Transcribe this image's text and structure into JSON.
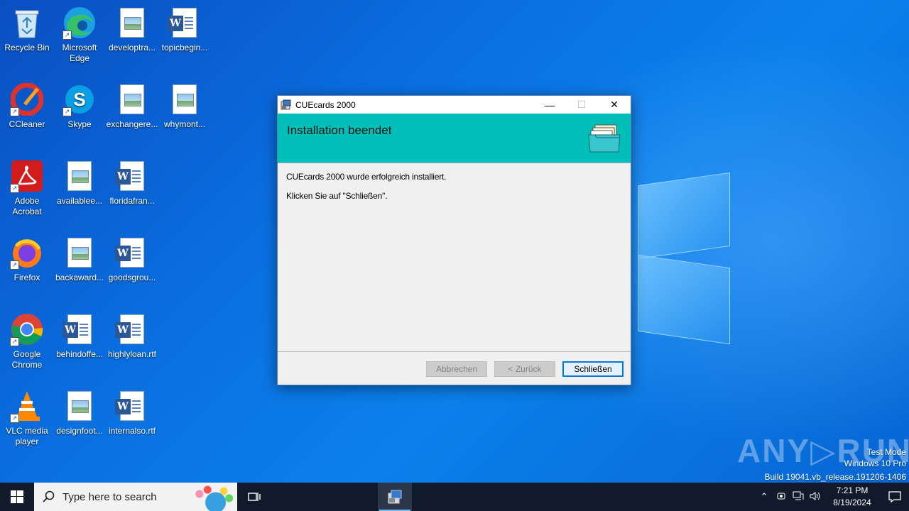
{
  "desktop": {
    "icons": [
      {
        "label": "Recycle Bin",
        "icon": "recycle-bin-icon"
      },
      {
        "label": "Microsoft Edge",
        "icon": "edge-icon"
      },
      {
        "label": "developtra...",
        "icon": "image-file-icon"
      },
      {
        "label": "topicbegin...",
        "icon": "word-doc-icon"
      },
      {
        "label": "CCleaner",
        "icon": "ccleaner-icon"
      },
      {
        "label": "Skype",
        "icon": "skype-icon"
      },
      {
        "label": "exchangere...",
        "icon": "image-file-icon"
      },
      {
        "label": "whymont...",
        "icon": "image-file-icon"
      },
      {
        "label": "Adobe Acrobat",
        "icon": "acrobat-icon"
      },
      {
        "label": "availablee...",
        "icon": "image-file-icon"
      },
      {
        "label": "floridafran...",
        "icon": "word-doc-icon"
      },
      {
        "label": "Firefox",
        "icon": "firefox-icon"
      },
      {
        "label": "backaward...",
        "icon": "image-file-icon"
      },
      {
        "label": "goodsgrou...",
        "icon": "word-doc-icon"
      },
      {
        "label": "Google Chrome",
        "icon": "chrome-icon"
      },
      {
        "label": "behindoffe...",
        "icon": "word-doc-icon"
      },
      {
        "label": "highlyloan.rtf",
        "icon": "word-doc-icon"
      },
      {
        "label": "VLC media player",
        "icon": "vlc-icon"
      },
      {
        "label": "designfoot...",
        "icon": "image-file-icon"
      },
      {
        "label": "internalso.rtf",
        "icon": "word-doc-icon"
      }
    ]
  },
  "dialog": {
    "title": "CUEcards 2000",
    "minimize": "—",
    "maximize": "☐",
    "close": "✕",
    "heading": "Installation beendet",
    "message1": "CUEcards 2000 wurde erfolgreich installiert.",
    "message2": "Klicken Sie auf \"Schließen\".",
    "buttons": {
      "cancel": "Abbrechen",
      "back": "< Zurück",
      "close": "Schließen"
    }
  },
  "watermark": {
    "brand": "ANY▷RUN",
    "line1": "Test Mode",
    "line2": "Windows 10 Pro",
    "line3": "Build 19041.vb_release.191206-1406"
  },
  "taskbar": {
    "search_placeholder": "Type here to search",
    "time": "7:21 PM",
    "date": "8/19/2024"
  },
  "colors": {
    "banner": "#00bfb8",
    "taskbar": "#101a2a",
    "accent": "#0078d7"
  }
}
